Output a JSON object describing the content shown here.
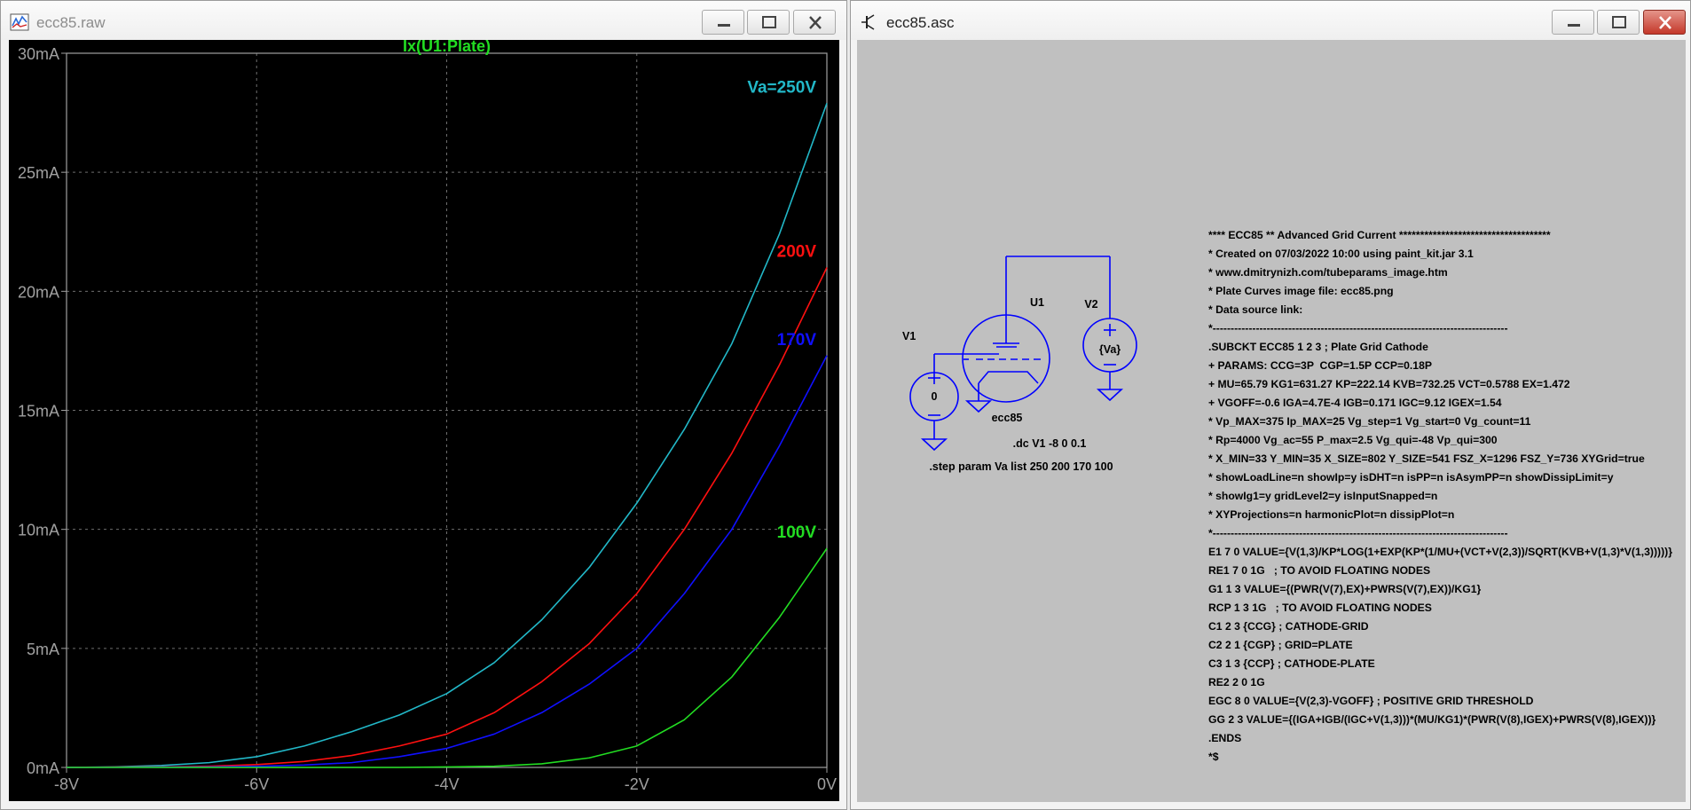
{
  "left_window": {
    "title": "ecc85.raw",
    "icon": "waveform-icon"
  },
  "right_window": {
    "title": "ecc85.asc",
    "icon": "transistor-icon"
  },
  "window_controls": {
    "minimize": "minimize-icon",
    "maximize": "maximize-icon",
    "close": "close-icon"
  },
  "colors": {
    "background": "#000000",
    "axis": "#a0a0a0",
    "grid": "#6e6e6e",
    "title": "#22dd22",
    "schematic_wire": "#0000ff",
    "schematic_bg": "#c0c0c0"
  },
  "chart_data": {
    "type": "line",
    "title": "Ix(U1:Plate)",
    "xlabel": "",
    "ylabel": "",
    "xlim": [
      -8,
      0
    ],
    "ylim": [
      0,
      30
    ],
    "xticks": [
      {
        "value": -8,
        "label": "-8V"
      },
      {
        "value": -6,
        "label": "-6V"
      },
      {
        "value": -4,
        "label": "-4V"
      },
      {
        "value": -2,
        "label": "-2V"
      },
      {
        "value": 0,
        "label": "0V"
      }
    ],
    "yticks": [
      {
        "value": 0,
        "label": "0mA"
      },
      {
        "value": 5,
        "label": "5mA"
      },
      {
        "value": 10,
        "label": "10mA"
      },
      {
        "value": 15,
        "label": "15mA"
      },
      {
        "value": 20,
        "label": "20mA"
      },
      {
        "value": 25,
        "label": "25mA"
      },
      {
        "value": 30,
        "label": "30mA"
      }
    ],
    "grid": true,
    "x": [
      -8,
      -7.5,
      -7,
      -6.5,
      -6,
      -5.5,
      -5,
      -4.5,
      -4,
      -3.5,
      -3,
      -2.5,
      -2,
      -1.5,
      -1,
      -0.5,
      0
    ],
    "series": [
      {
        "name": "Va=250V",
        "color": "#22b8c8",
        "values": [
          0,
          0.02,
          0.08,
          0.2,
          0.45,
          0.9,
          1.5,
          2.2,
          3.1,
          4.4,
          6.2,
          8.4,
          11.1,
          14.2,
          17.8,
          22.4,
          27.9
        ]
      },
      {
        "name": "200V",
        "color": "#ff1010",
        "values": [
          0,
          0.01,
          0.02,
          0.05,
          0.12,
          0.25,
          0.5,
          0.9,
          1.4,
          2.3,
          3.6,
          5.2,
          7.3,
          10.0,
          13.2,
          16.9,
          21.0
        ]
      },
      {
        "name": "170V",
        "color": "#1010ff",
        "values": [
          0,
          0,
          0.01,
          0.02,
          0.05,
          0.1,
          0.2,
          0.45,
          0.8,
          1.4,
          2.3,
          3.5,
          5.0,
          7.3,
          10.0,
          13.5,
          17.3
        ]
      },
      {
        "name": "100V",
        "color": "#22dd22",
        "values": [
          0,
          0,
          0,
          0,
          0,
          0,
          0,
          0,
          0.02,
          0.05,
          0.15,
          0.4,
          0.9,
          2.0,
          3.8,
          6.3,
          9.2
        ]
      }
    ]
  },
  "schematic": {
    "v1_label": "V1",
    "v1_value": "0",
    "u1_label": "U1",
    "u1_model": "ecc85",
    "v2_label": "V2",
    "v2_value": "{Va}",
    "dc_directive": ".dc V1 -8 0 0.1",
    "step_directive": ".step param Va  list 250 200 170 100"
  },
  "netlist": [
    "**** ECC85 ** Advanced Grid Current ************************************",
    "* Created on 07/03/2022 10:00 using paint_kit.jar 3.1",
    "* www.dmitrynizh.com/tubeparams_image.htm",
    "* Plate Curves image file: ecc85.png",
    "* Data source link:",
    "*----------------------------------------------------------------------------------",
    ".SUBCKT ECC85 1 2 3 ; Plate Grid Cathode",
    "+ PARAMS: CCG=3P  CGP=1.5P CCP=0.18P",
    "+ MU=65.79 KG1=631.27 KP=222.14 KVB=732.25 VCT=0.5788 EX=1.472",
    "+ VGOFF=-0.6 IGA=4.7E-4 IGB=0.171 IGC=9.12 IGEX=1.54",
    "* Vp_MAX=375 Ip_MAX=25 Vg_step=1 Vg_start=0 Vg_count=11",
    "* Rp=4000 Vg_ac=55 P_max=2.5 Vg_qui=-48 Vp_qui=300",
    "* X_MIN=33 Y_MIN=35 X_SIZE=802 Y_SIZE=541 FSZ_X=1296 FSZ_Y=736 XYGrid=true",
    "* showLoadLine=n showIp=y isDHT=n isPP=n isAsymPP=n showDissipLimit=y",
    "* showIg1=y gridLevel2=y isInputSnapped=n",
    "* XYProjections=n harmonicPlot=n dissipPlot=n",
    "*----------------------------------------------------------------------------------",
    "E1 7 0 VALUE={V(1,3)/KP*LOG(1+EXP(KP*(1/MU+(VCT+V(2,3))/SQRT(KVB+V(1,3)*V(1,3)))))}",
    "RE1 7 0 1G   ; TO AVOID FLOATING NODES",
    "G1 1 3 VALUE={(PWR(V(7),EX)+PWRS(V(7),EX))/KG1}",
    "RCP 1 3 1G   ; TO AVOID FLOATING NODES",
    "C1 2 3 {CCG} ; CATHODE-GRID",
    "C2 2 1 {CGP} ; GRID=PLATE",
    "C3 1 3 {CCP} ; CATHODE-PLATE",
    "RE2 2 0 1G",
    "EGC 8 0 VALUE={V(2,3)-VGOFF} ; POSITIVE GRID THRESHOLD",
    "GG 2 3 VALUE={(IGA+IGB/(IGC+V(1,3)))*(MU/KG1)*(PWR(V(8),IGEX)+PWRS(V(8),IGEX))}",
    ".ENDS",
    "*$"
  ]
}
